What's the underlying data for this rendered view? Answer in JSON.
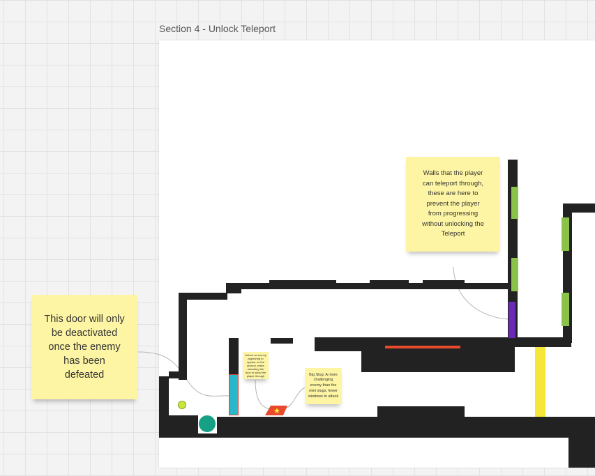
{
  "frame": {
    "title": "Section 4 - Unlock Teleport"
  },
  "notes": {
    "door_note": "This door will only\nbe deactivated\nonce the enemy\nhas been\ndefeated",
    "walls_note": "Walls that the player\ncan teleport through,\nthese are here to\nprevent the player\nfrom progressing\nwithout unlocking the\nTeleport",
    "small_note": "Unlock an enemy appearing to appear on the ground, make unlocking the door to allow the player through",
    "big_slug_note": "Big Slug: A more\nchallenging\nenemy than the\nmini slugs, fewer\nwindows to attack"
  },
  "colors": {
    "wall": "#222222",
    "teleport_wall": "#8bc34a",
    "purple_door": "#6a2ab4",
    "yellow_bar": "#f5e63a",
    "cyan_door": "#2ab7c9",
    "red_ledge": "#e84a2c",
    "sticky_note": "#fdf5a3",
    "player_marker": "#16a085",
    "pickup": "#c8e63a",
    "enemy": "#e84a2c",
    "enemy_star": "#f5e63a"
  },
  "icons": {
    "enemy": "star-icon",
    "player": "circle-icon",
    "pickup": "dot-icon"
  }
}
